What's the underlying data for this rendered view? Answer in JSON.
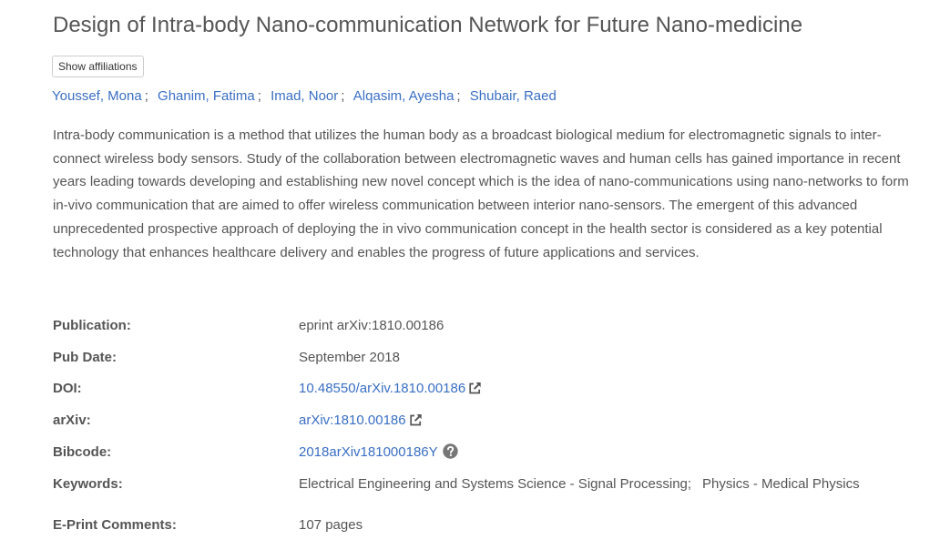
{
  "title": {
    "prefix": "Design of Intra-body ",
    "highlighted": "Nano-communication Network for Future Nano-medicine"
  },
  "affiliations_button": "Show affiliations",
  "authors": [
    "Youssef, Mona",
    "Ghanim, Fatima",
    "Imad, Noor",
    "Alqasim, Ayesha",
    "Shubair, Raed"
  ],
  "author_separator": ";",
  "abstract": "Intra-body communication is a method that utilizes the human body as a broadcast biological medium for electromagnetic signals to inter-connect wireless body sensors. Study of the collaboration between electromagnetic waves and human cells has gained importance in recent years leading towards developing and establishing new novel concept which is the idea of nano-communications using nano-networks to form in-vivo communication that are aimed to offer wireless communication between interior nano-sensors. The emergent of this advanced unprecedented prospective approach of deploying the in vivo communication concept in the health sector is considered as a key potential technology that enhances healthcare delivery and enables the progress of future applications and services.",
  "metadata": {
    "publication": {
      "label": "Publication:",
      "value": "eprint arXiv:1810.00186"
    },
    "pub_date": {
      "label": "Pub Date:",
      "value": "September 2018"
    },
    "doi": {
      "label": "DOI:",
      "value": "10.48550/arXiv.1810.00186",
      "icon": "external-link-icon"
    },
    "arxiv": {
      "label": "arXiv:",
      "value": "arXiv:1810.00186",
      "icon": "external-link-icon"
    },
    "bibcode": {
      "label": "Bibcode:",
      "value": "2018arXiv181000186Y",
      "icon": "help-icon"
    },
    "keywords": {
      "label": "Keywords:",
      "values": [
        "Electrical Engineering and Systems Science - Signal Processing;",
        "Physics - Medical Physics"
      ]
    },
    "eprint_comments": {
      "label": "E-Print Comments:",
      "value": "107 pages"
    }
  },
  "colors": {
    "link": "#3a6fc4",
    "text": "#555555",
    "highlight": "#f7ec26"
  }
}
